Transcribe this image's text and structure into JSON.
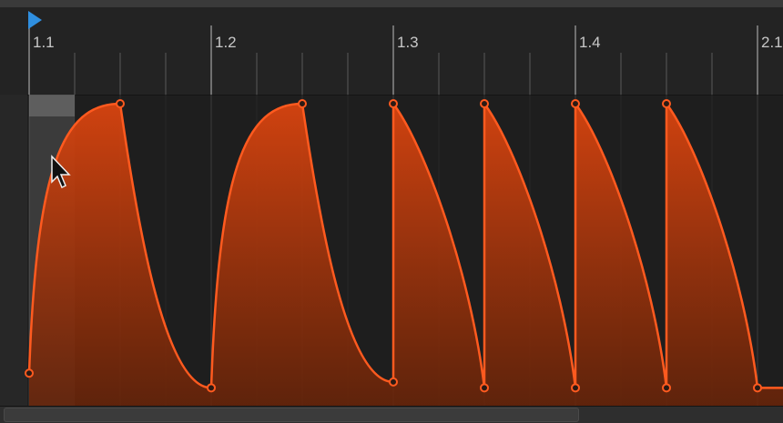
{
  "timeline": {
    "bar_labels": [
      "1.1",
      "1.2",
      "1.3",
      "1.4",
      "2.1"
    ],
    "bar_start": 1.1,
    "bar_end": 2.1
  },
  "colors": {
    "accent": "#ff5a1f",
    "playhead": "#2f8fe0",
    "grid": "#3a3a3a",
    "ruler_tick": "#5a5a5a"
  },
  "envelope": {
    "points": [
      {
        "beat": 0.0,
        "value": 0.08
      },
      {
        "beat": 0.5,
        "value": 1.0
      },
      {
        "beat": 1.0,
        "value": 0.03
      },
      {
        "beat": 1.5,
        "value": 1.0
      },
      {
        "beat": 2.0,
        "value": 0.05
      },
      {
        "beat": 2.0,
        "value": 1.0
      },
      {
        "beat": 2.5,
        "value": 0.03
      },
      {
        "beat": 2.5,
        "value": 1.0
      },
      {
        "beat": 3.0,
        "value": 0.03
      },
      {
        "beat": 3.0,
        "value": 1.0
      },
      {
        "beat": 3.5,
        "value": 0.03
      },
      {
        "beat": 3.5,
        "value": 1.0
      },
      {
        "beat": 4.0,
        "value": 0.03
      }
    ]
  },
  "loop_region": {
    "start_beat": 0.0,
    "end_beat": 0.25
  }
}
